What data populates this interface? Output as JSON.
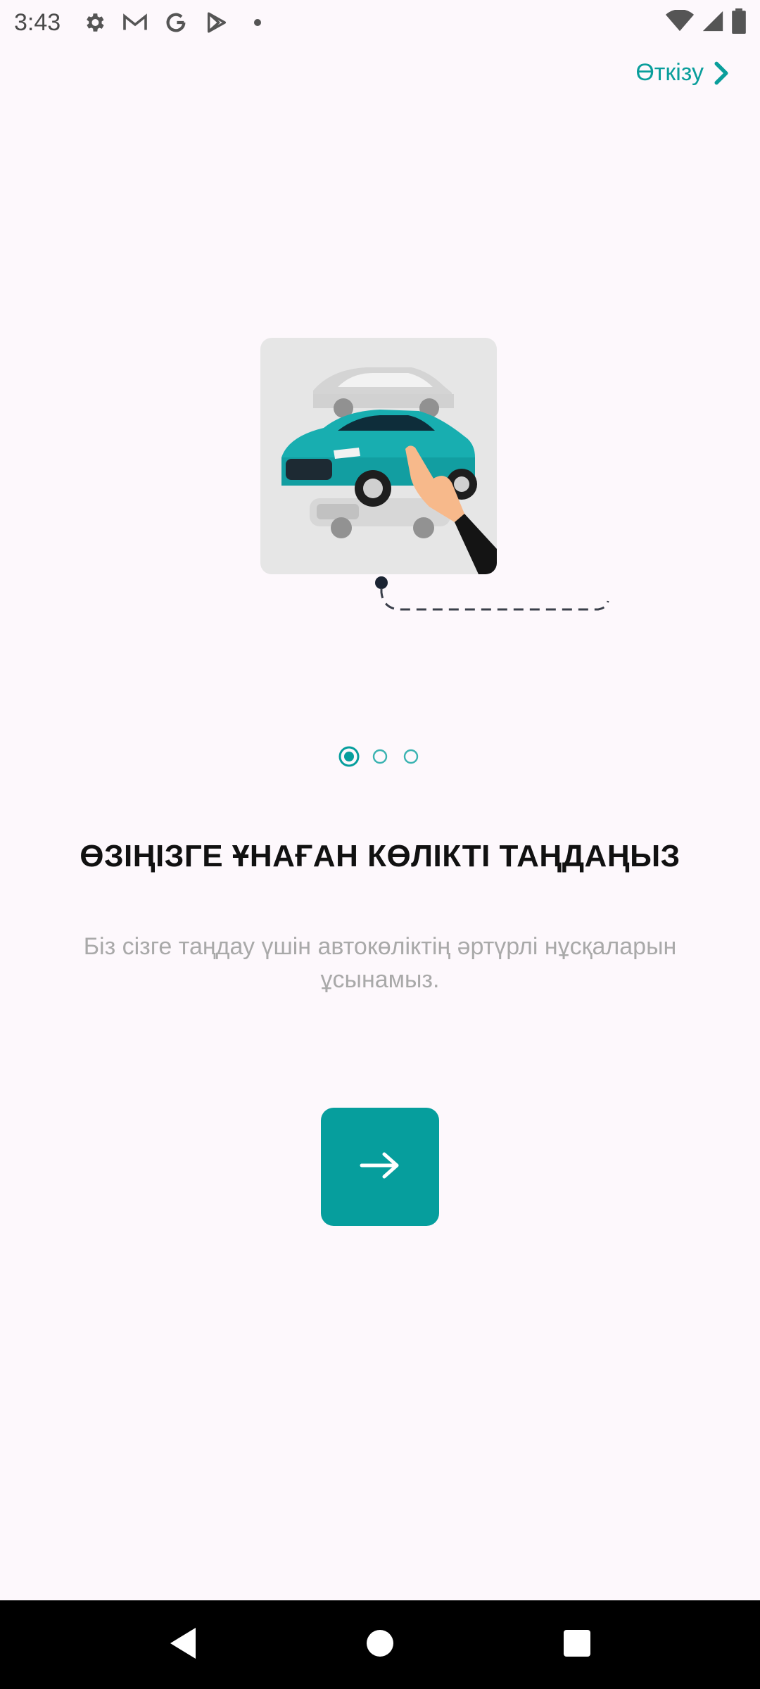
{
  "status_bar": {
    "time": "3:43",
    "left_icons": [
      "settings-icon",
      "gmail-icon",
      "google-icon",
      "play-store-icon",
      "dot-icon"
    ],
    "right_icons": [
      "wifi-icon",
      "signal-icon",
      "battery-icon"
    ]
  },
  "skip": {
    "label": "Өткізу"
  },
  "pager": {
    "total": 3,
    "active": 1
  },
  "content": {
    "title": "ӨЗІҢІЗГЕ ҰНАҒАН КӨЛІКТІ ТАҢДАҢЫЗ",
    "subtitle": "Біз сізге таңдау үшін автокөліктің әртүрлі нұсқаларын ұсынамыз."
  },
  "next_button": {
    "icon": "arrow-right-icon"
  },
  "colors": {
    "accent": "#069e9d",
    "background": "#fdf8fc",
    "title": "#111111",
    "subtitle": "#a9a9a9"
  },
  "nav_bar": {
    "buttons": [
      "back-icon",
      "home-icon",
      "recents-icon"
    ]
  }
}
